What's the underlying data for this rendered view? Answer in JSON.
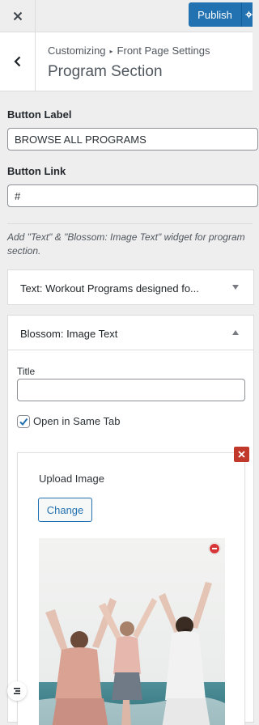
{
  "header": {
    "close_icon": "close-icon",
    "publish_label": "Publish",
    "settings_icon": "gear-icon",
    "accent_color": "#2271b1"
  },
  "section": {
    "back_icon": "chevron-left-icon",
    "breadcrumb_root": "Customizing",
    "breadcrumb_separator": "▸",
    "breadcrumb_parent": "Front Page Settings",
    "title": "Program Section"
  },
  "controls": {
    "button_label": {
      "label": "Button Label",
      "value": "BROWSE ALL PROGRAMS"
    },
    "button_link": {
      "label": "Button Link",
      "value": "#"
    },
    "description": "Add \"Text\" & \"Blossom: Image Text\" widget for program section."
  },
  "widgets": [
    {
      "type": "Text:",
      "title": "Workout Programs designed fo...",
      "expanded": false
    },
    {
      "type": "Blossom: Image Text",
      "title": "",
      "expanded": true
    }
  ],
  "image_text_widget": {
    "title_label": "Title",
    "title_value": "",
    "open_same_tab_label": "Open in Same Tab",
    "open_same_tab_checked": true,
    "upload_label": "Upload Image",
    "change_label": "Change",
    "remove_image_icon": "remove-circle-icon",
    "remove_widget_icon": "close-icon",
    "image_alt": "yoga-group-photo"
  },
  "footer": {
    "collapse_icon": "menu-handle-icon"
  }
}
